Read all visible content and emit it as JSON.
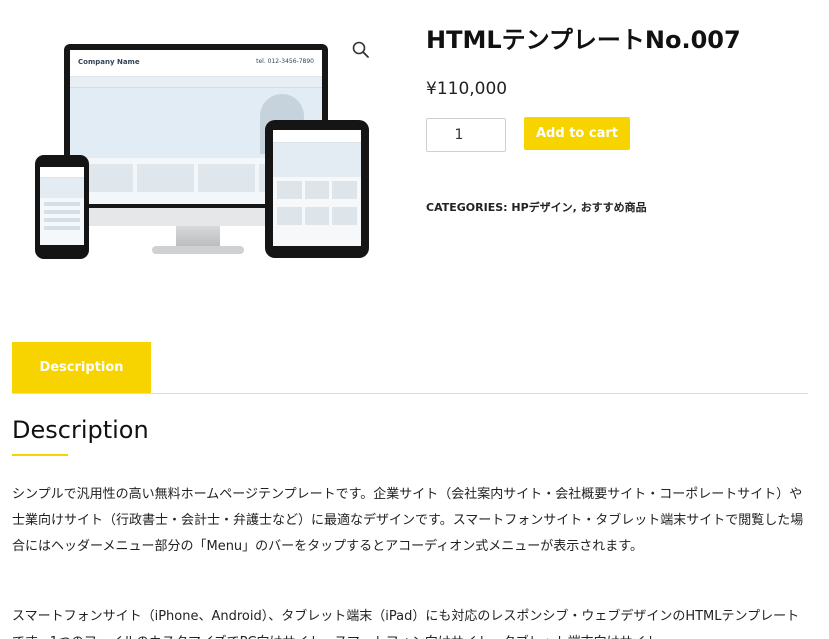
{
  "product": {
    "title": "HTMLテンプレートNo.007",
    "price": "¥110,000",
    "quantity": "1",
    "add_to_cart_label": "Add to cart",
    "categories_label": "CATEGORIES:",
    "categories": [
      "HPデザイン",
      "おすすめ商品"
    ],
    "categories_separator": ","
  },
  "gallery": {
    "zoom_icon": "magnifier-icon",
    "mock_brand": "Company Name",
    "mock_tel": "tel. 012-3456-7890"
  },
  "tabs": [
    {
      "label": "Description",
      "active": true
    }
  ],
  "description": {
    "heading": "Description",
    "paragraphs": [
      "シンプルで汎用性の高い無料ホームページテンプレートです。企業サイト（会社案内サイト・会社概要サイト・コーポレートサイト）や士業向けサイト（行政書士・会計士・弁護士など）に最適なデザインです。スマートフォンサイト・タブレット端末サイトで閲覧した場合にはヘッダーメニュー部分の「Menu」のバーをタップするとアコーディオン式メニューが表示されます。",
      "スマートフォンサイト（iPhone、Android）、タブレット端末（iPad）にも対応のレスポンシブ・ウェブデザインのHTMLテンプレートです。1つのファイルのカスタマイズでPC向けサイト、スマートフォン向けサイト、タブレット端末向けサイト"
    ]
  },
  "colors": {
    "accent": "#f7d400",
    "text": "#222222",
    "border": "#dcdcdc"
  }
}
